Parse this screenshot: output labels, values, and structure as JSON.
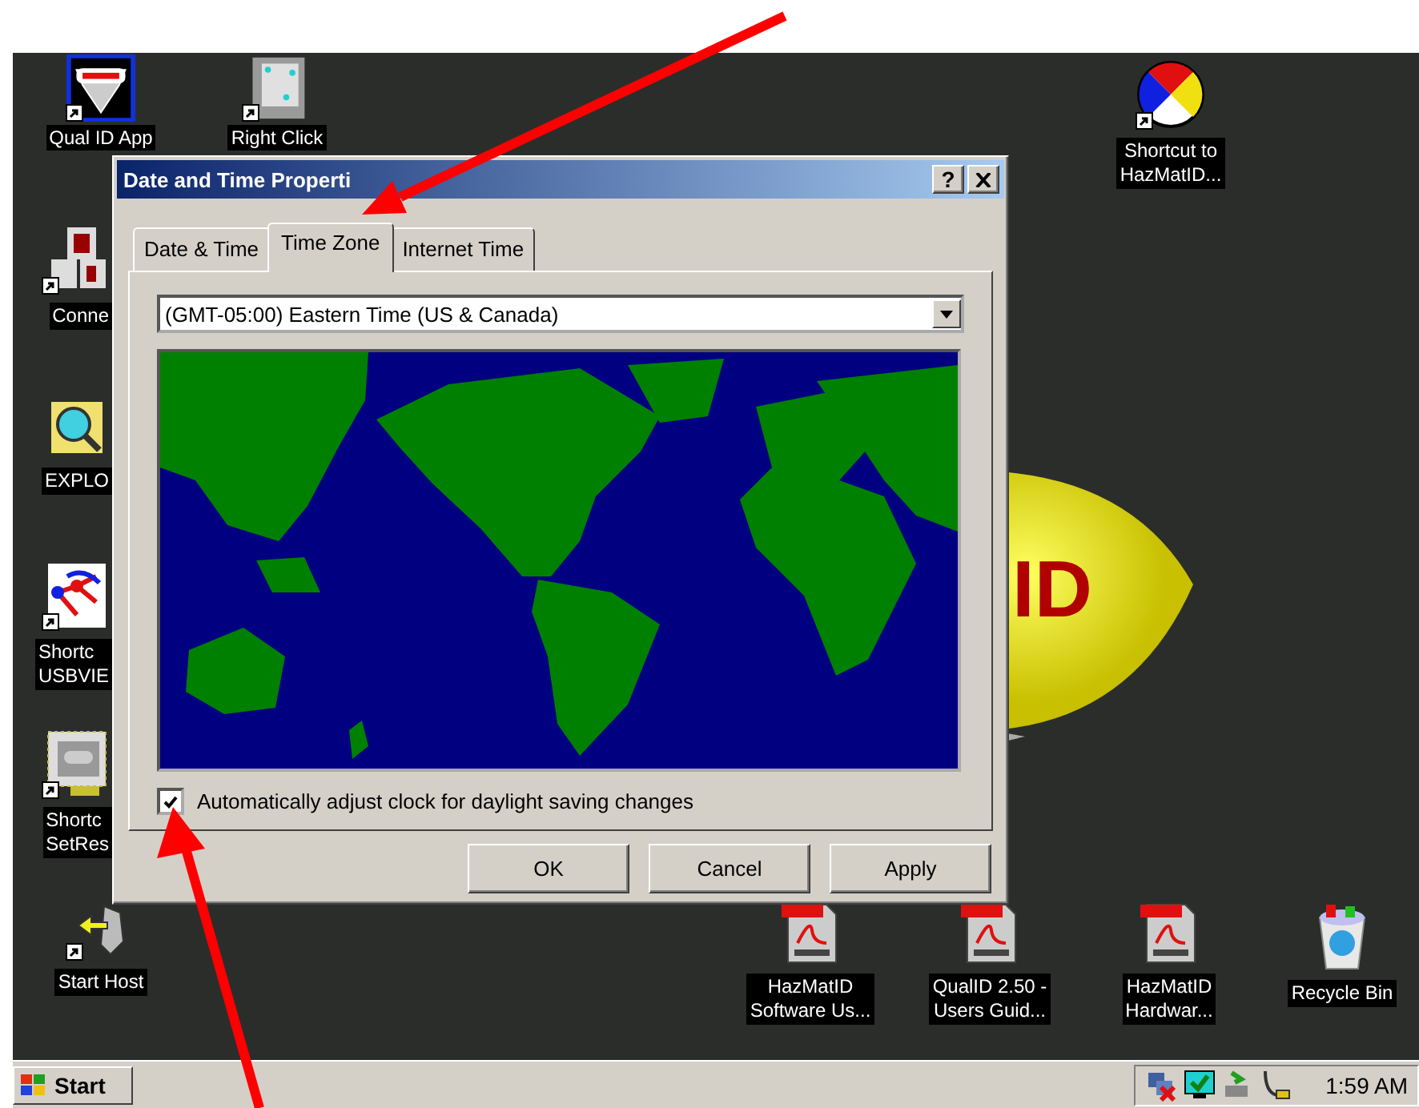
{
  "desktop": {
    "wallpaper": {
      "logo_text": "ID"
    },
    "icons": [
      {
        "kind": "qualid",
        "label": [
          "Qual ID App"
        ],
        "shortcut": true
      },
      {
        "kind": "cube",
        "label": [
          "Right Click"
        ],
        "shortcut": true
      },
      {
        "kind": "pie",
        "label": [
          "Shortcut to",
          "HazMatID..."
        ],
        "shortcut": true
      },
      {
        "kind": "blocks",
        "label": [
          "Conne"
        ],
        "shortcut": true
      },
      {
        "kind": "magnifier",
        "label": [
          "EXPLO"
        ],
        "shortcut": false
      },
      {
        "kind": "diagram",
        "label": [
          "Shortc",
          "USBVIE"
        ],
        "shortcut": true
      },
      {
        "kind": "monitor",
        "label": [
          "Shortc",
          "SetRes"
        ],
        "shortcut": true
      },
      {
        "kind": "host",
        "label": [
          "Start Host"
        ],
        "shortcut": true
      },
      {
        "kind": "pdf",
        "label": [
          "HazMatID",
          "Software Us..."
        ],
        "shortcut": false
      },
      {
        "kind": "pdf",
        "label": [
          "QualID 2.50 -",
          "Users Guid..."
        ],
        "shortcut": false
      },
      {
        "kind": "pdf",
        "label": [
          "HazMatID",
          "Hardwar..."
        ],
        "shortcut": false
      },
      {
        "kind": "recycle",
        "label": [
          "Recycle Bin"
        ],
        "shortcut": false
      }
    ]
  },
  "dialog": {
    "title": "Date and Time Properti",
    "help_button": "?",
    "tabs": [
      {
        "label": "Date & Time",
        "selected": false
      },
      {
        "label": "Time Zone",
        "selected": true
      },
      {
        "label": "Internet Time",
        "selected": false
      }
    ],
    "time_zone": {
      "value": "(GMT-05:00) Eastern Time (US & Canada)"
    },
    "daylight_saving": {
      "label": "Automatically adjust clock for daylight saving changes",
      "checked": true
    },
    "buttons": [
      "OK",
      "Cancel",
      "Apply"
    ]
  },
  "taskbar": {
    "start": "Start",
    "clock": "1:59 AM"
  }
}
